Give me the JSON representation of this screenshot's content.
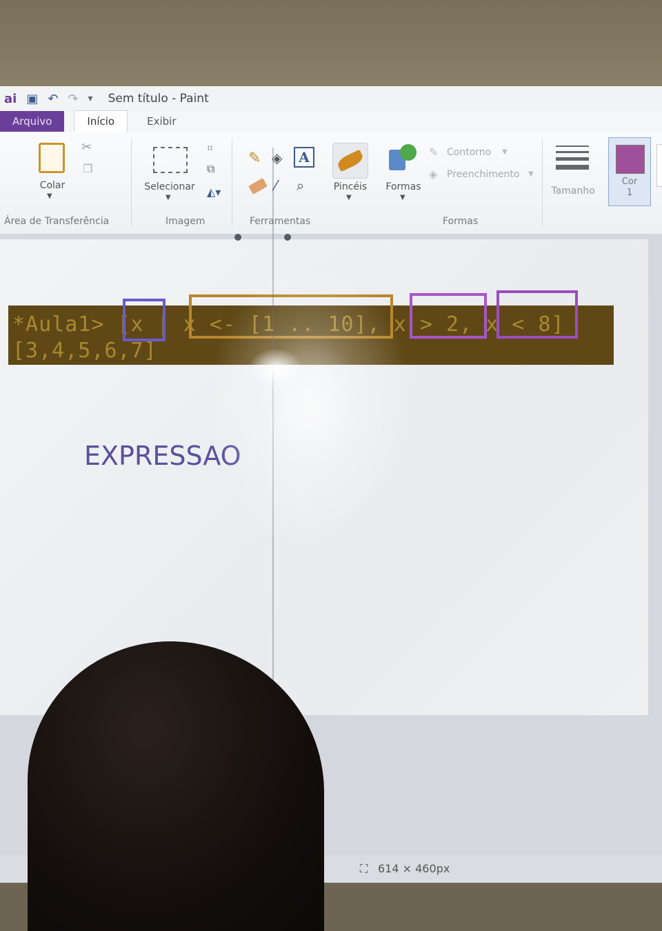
{
  "window": {
    "title": "Sem título - Paint"
  },
  "tabs": {
    "file": "Arquivo",
    "home": "Início",
    "view": "Exibir"
  },
  "ribbon": {
    "paste": "Colar",
    "select": "Selecionar",
    "brushes": "Pincéis",
    "shapes": "Formas",
    "outline": "Contorno",
    "fill": "Preenchimento",
    "size": "Tamanho",
    "color1": "Cor\n1",
    "groups": {
      "clipboard": "Área de Transferência",
      "image": "Imagem",
      "tools": "Ferramentas",
      "shapes": "Formas"
    }
  },
  "canvas": {
    "code_line1": "*Aula1> [x | x <- [1 .. 10], x > 2, x < 8]",
    "code_line2": "[3,4,5,6,7]",
    "annotation": "EXPRESSAO"
  },
  "status": {
    "dimensions": "614 × 460px"
  },
  "colors": {
    "accent": "#6a3f9a",
    "code_text": "#a8892f",
    "code_background": "#5f4816",
    "box_blue": "#6a5acd",
    "box_orange": "#b8862b",
    "box_purple": "#a855c8",
    "annotation_text": "#5a4f9c"
  }
}
